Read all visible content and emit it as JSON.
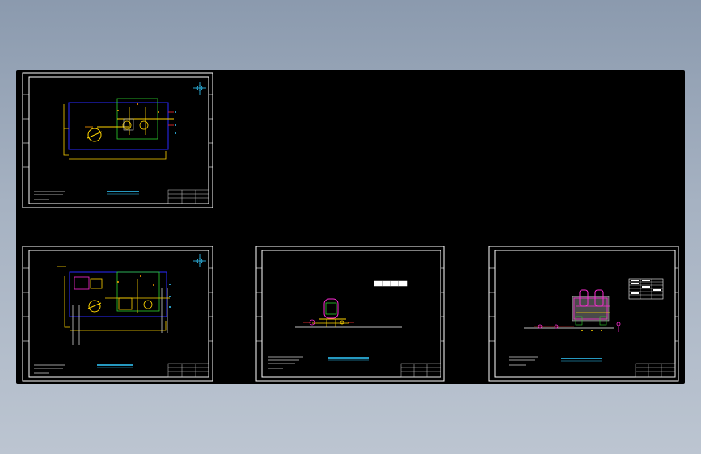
{
  "app": {
    "viewport_background": "#98a6b8",
    "canvas_background": "#000000"
  },
  "colors": {
    "frame": "#ffffff",
    "yellow": "#ffd400",
    "blue": "#2a2aff",
    "green": "#2fd32f",
    "cyan": "#33ccff",
    "magenta": "#ff2bd6",
    "orange": "#ff9d00",
    "red": "#ff3030",
    "light": "#cfcfcf"
  },
  "sheets": [
    {
      "id": "sheet-1",
      "kind": "plan-view",
      "title_bar_color": "#33ccff"
    },
    {
      "id": "sheet-2",
      "kind": "plan-view-detail",
      "title_bar_color": "#33ccff"
    },
    {
      "id": "sheet-3",
      "kind": "elevation-single",
      "title_bar_color": "#33ccff"
    },
    {
      "id": "sheet-4",
      "kind": "elevation-double",
      "title_bar_color": "#33ccff"
    }
  ]
}
